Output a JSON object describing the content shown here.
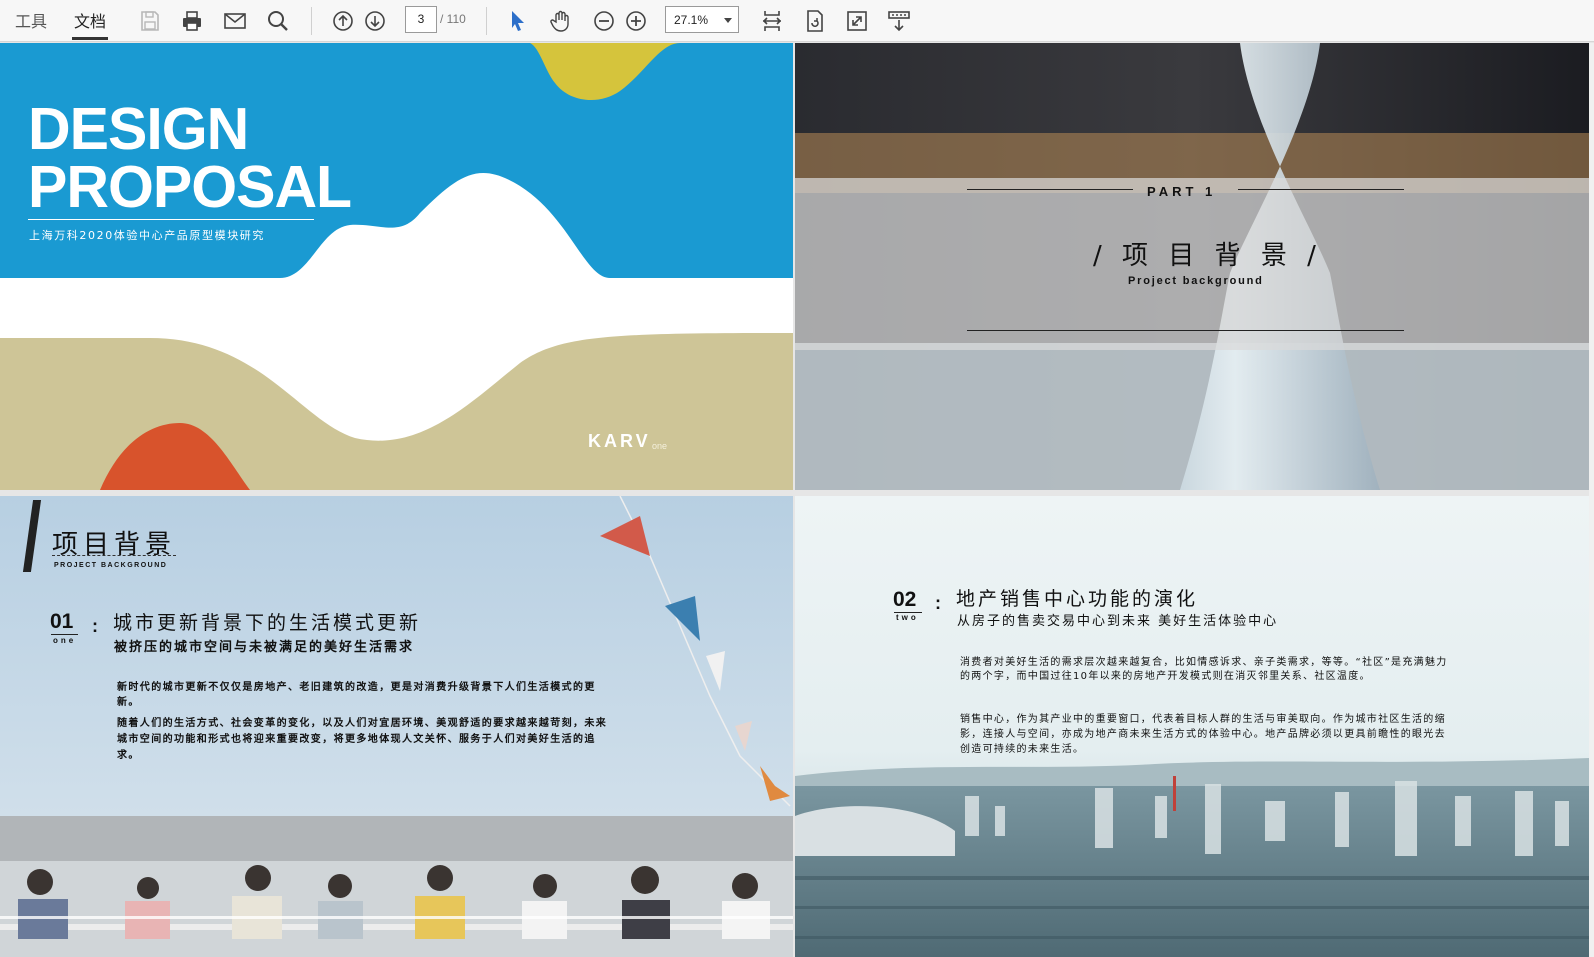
{
  "toolbar": {
    "tab_tools": "工具",
    "tab_document": "文档",
    "current_page": "3",
    "total_pages": "/ 110",
    "zoom": "27.1%",
    "icons": [
      "save-icon",
      "print-icon",
      "mail-icon",
      "search-icon",
      "page-up-icon",
      "page-down-icon",
      "select-cursor-icon",
      "hand-icon",
      "zoom-out-icon",
      "zoom-in-icon",
      "fit-width-icon",
      "rotate-icon",
      "full-screen-icon",
      "read-mode-icon"
    ]
  },
  "page1": {
    "title_line1": "DESIGN",
    "title_line2": "PROPOSAL",
    "subtitle": "上海万科2020体验中心产品原型模块研究",
    "logo": "KARV",
    "logo_suffix": "one",
    "colors": {
      "blue": "#1a9ad2",
      "yellow": "#d5c43c",
      "tan": "#cec597",
      "orange": "#d8532c"
    }
  },
  "page2": {
    "part": "PART 1",
    "title": "/ 项 目 背 景 /",
    "subtitle": "Project background"
  },
  "page3": {
    "heading": "项目背景",
    "heading_en": "PROJECT BACKGROUND",
    "section_num": "01",
    "section_word": "one",
    "section_title": "城市更新背景下的生活模式更新",
    "section_subtitle": "被挤压的城市空间与未被满足的美好生活需求",
    "para1": "新时代的城市更新不仅仅是房地产、老旧建筑的改造，更是对消费升级背景下人们生活模式的更新。",
    "para2": "随着人们的生活方式、社会变革的变化，以及人们对宜居环境、美观舒适的要求越来越苛刻，未来城市空间的功能和形式也将迎来重要改变，将更多地体现人文关怀、服务于人们对美好生活的追求。"
  },
  "page4": {
    "section_num": "02",
    "section_word": "two",
    "section_title": "地产销售中心功能的演化",
    "section_subtitle": "从房子的售卖交易中心到未来 美好生活体验中心",
    "para1": "消费者对美好生活的需求层次越来越复合，比如情感诉求、亲子类需求，等等。“社区”是充满魅力的两个字，而中国过往10年以来的房地产开发模式则在消灭邻里关系、社区温度。",
    "para2": "销售中心，作为其产业中的重要窗口，代表着目标人群的生活与审美取向。作为城市社区生活的缩影，连接人与空间，亦成为地产商未来生活方式的体验中心。地产品牌必须以更具前瞻性的眼光去创造可持续的未来生活。"
  }
}
